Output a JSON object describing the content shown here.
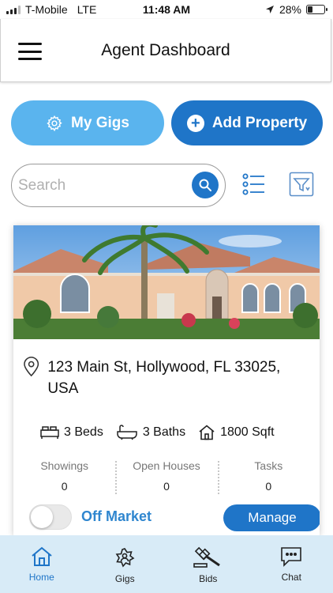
{
  "status_bar": {
    "carrier": "T-Mobile",
    "network": "LTE",
    "time": "11:48 AM",
    "battery": "28%",
    "battery_level": 0.28
  },
  "header": {
    "title": "Agent Dashboard",
    "menu_icon": "hamburger-icon"
  },
  "actions": {
    "my_gigs_label": "My Gigs",
    "add_property_label": "Add Property"
  },
  "search": {
    "placeholder": "Search",
    "value": ""
  },
  "property": {
    "address": "123 Main St, Hollywood, FL 33025, USA",
    "beds": "3 Beds",
    "baths": "3 Baths",
    "sqft": "1800 Sqft",
    "stats": [
      {
        "label": "Showings",
        "value": "0"
      },
      {
        "label": "Open Houses",
        "value": "0"
      },
      {
        "label": "Tasks",
        "value": "0"
      }
    ],
    "market_status": "Off Market",
    "manage_label": "Manage"
  },
  "tabs": [
    {
      "label": "Home",
      "icon": "home-icon",
      "active": true
    },
    {
      "label": "Gigs",
      "icon": "gigs-icon",
      "active": false
    },
    {
      "label": "Bids",
      "icon": "gavel-icon",
      "active": false
    },
    {
      "label": "Chat",
      "icon": "chat-icon",
      "active": false
    }
  ],
  "colors": {
    "primary": "#1f75c8",
    "light_primary": "#5ab4ee",
    "tabbar_bg": "#d8ebf7",
    "status_text": "#2f86cf"
  }
}
